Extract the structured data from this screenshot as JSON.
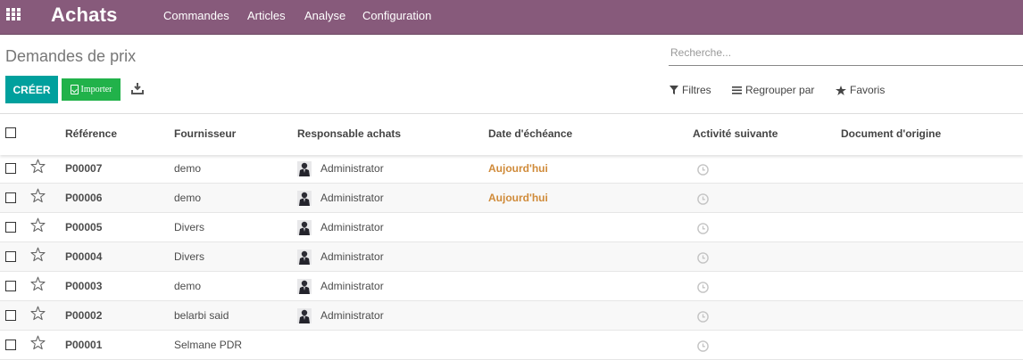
{
  "navbar": {
    "app_title": "Achats",
    "menu": [
      "Commandes",
      "Articles",
      "Analyse",
      "Configuration"
    ],
    "background_color": "#875a7b"
  },
  "control_panel": {
    "breadcrumb": "Demandes de prix",
    "search_placeholder": "Recherche...",
    "create_label": "CRÉER",
    "import_label": "Importer",
    "filters_label": "Filtres",
    "group_by_label": "Regrouper par",
    "favorites_label": "Favoris",
    "accent_color": "#00a09d",
    "import_color": "#21b24a"
  },
  "table": {
    "columns": [
      "Référence",
      "Fournisseur",
      "Responsable achats",
      "Date d'échéance",
      "Activité suivante",
      "Document d'origine"
    ],
    "rows": [
      {
        "reference": "P00007",
        "supplier": "demo",
        "buyer": "Administrator",
        "due": "Aujourd'hui"
      },
      {
        "reference": "P00006",
        "supplier": "demo",
        "buyer": "Administrator",
        "due": "Aujourd'hui"
      },
      {
        "reference": "P00005",
        "supplier": "Divers",
        "buyer": "Administrator",
        "due": ""
      },
      {
        "reference": "P00004",
        "supplier": "Divers",
        "buyer": "Administrator",
        "due": ""
      },
      {
        "reference": "P00003",
        "supplier": "demo",
        "buyer": "Administrator",
        "due": ""
      },
      {
        "reference": "P00002",
        "supplier": "belarbi said",
        "buyer": "Administrator",
        "due": ""
      },
      {
        "reference": "P00001",
        "supplier": "Selmane PDR",
        "buyer": "",
        "due": ""
      }
    ],
    "due_color": "#d08b3a"
  }
}
